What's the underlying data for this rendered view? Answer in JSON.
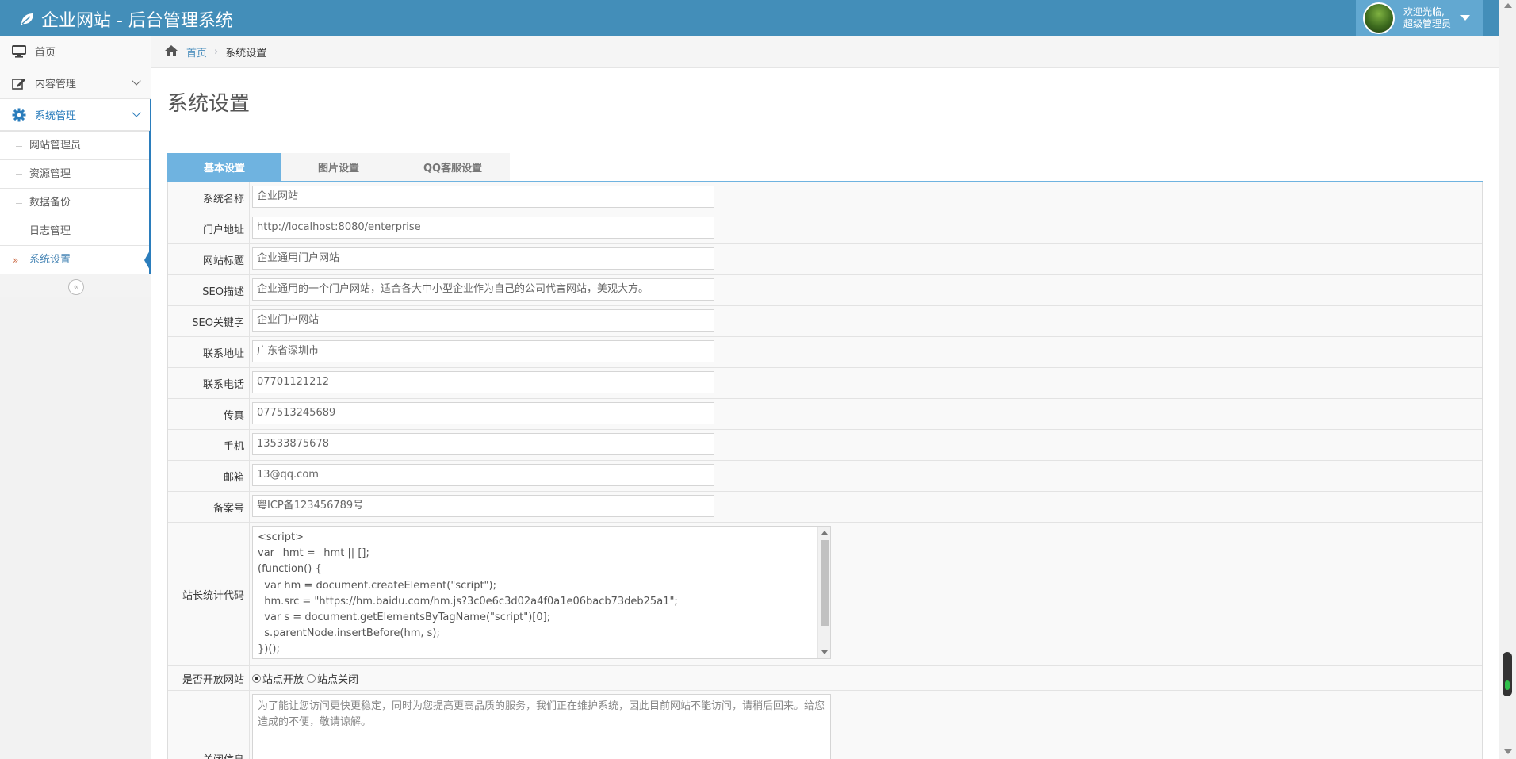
{
  "header": {
    "brand": "企业网站 - 后台管理系统",
    "user_line1": "欢迎光临,",
    "user_line2": "超级管理员"
  },
  "sidebar": {
    "items": [
      {
        "label": "首页",
        "icon": "desktop-icon"
      },
      {
        "label": "内容管理",
        "icon": "edit-icon"
      },
      {
        "label": "系统管理",
        "icon": "gear-icon"
      }
    ],
    "submenu": [
      {
        "label": "网站管理员"
      },
      {
        "label": "资源管理"
      },
      {
        "label": "数据备份"
      },
      {
        "label": "日志管理"
      },
      {
        "label": "系统设置"
      }
    ],
    "collapse_glyph": "«"
  },
  "breadcrumb": {
    "home": "首页",
    "current": "系统设置"
  },
  "page": {
    "title": "系统设置"
  },
  "tabs": [
    {
      "label": "基本设置",
      "active": true
    },
    {
      "label": "图片设置",
      "active": false
    },
    {
      "label": "QQ客服设置",
      "active": false
    }
  ],
  "form": {
    "fields": [
      {
        "label": "系统名称",
        "value": "企业网站"
      },
      {
        "label": "门户地址",
        "value": "http://localhost:8080/enterprise"
      },
      {
        "label": "网站标题",
        "value": "企业通用门户网站"
      },
      {
        "label": "SEO描述",
        "value": "企业通用的一个门户网站，适合各大中小型企业作为自己的公司代言网站，美观大方。"
      },
      {
        "label": "SEO关键字",
        "value": "企业门户网站"
      },
      {
        "label": "联系地址",
        "value": "广东省深圳市"
      },
      {
        "label": "联系电话",
        "value": "07701121212"
      },
      {
        "label": "传真",
        "value": "077513245689"
      },
      {
        "label": "手机",
        "value": "13533875678"
      },
      {
        "label": "邮箱",
        "value": "13@qq.com"
      },
      {
        "label": "备案号",
        "value": "粤ICP备123456789号"
      }
    ],
    "stats_label": "站长统计代码",
    "stats_code": [
      "<script>",
      "var _hmt = _hmt || [];",
      "(function() {",
      "  var hm = document.createElement(\"script\");",
      "  hm.src = \"https://hm.baidu.com/hm.js?3c0e6c3d02a4f0a1e06bacb73deb25a1\";",
      "  var s = document.getElementsByTagName(\"script\")[0];",
      "  s.parentNode.insertBefore(hm, s);",
      "})();"
    ],
    "open_label": "是否开放网站",
    "open_option": "站点开放",
    "close_option": "站点关闭",
    "close_msg_label": "关闭信息",
    "close_msg": "为了能让您访问更快更稳定，同时为您提高更高品质的服务，我们正在维护系统，因此目前网站不能访问，请稍后回来。给您造成的不便，敬请谅解。"
  }
}
